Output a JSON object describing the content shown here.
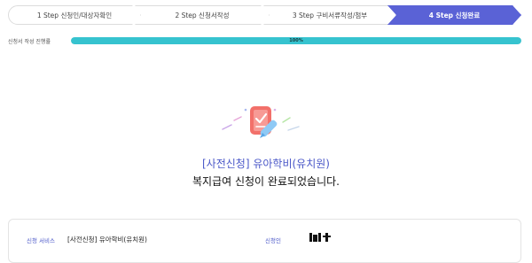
{
  "steps": [
    {
      "label": "1 Step 신청인/대상자확인",
      "active": false
    },
    {
      "label": "2 Step 신청서작성",
      "active": false
    },
    {
      "label": "3 Step 구비서류작성/첨부",
      "active": false
    },
    {
      "label": "4 Step 신청완료",
      "active": true
    }
  ],
  "progress": {
    "label": "신청서 작성 진행률",
    "value": 100,
    "text": "100%"
  },
  "service_title": "[사전신청] 유아학비(유치원)",
  "done_message": "복지급여 신청이 완료되었습니다.",
  "info": {
    "service_label": "신청 서비스",
    "service_value": "[사전신청] 유아학비(유치원)",
    "applicant_label": "신청인"
  },
  "colors": {
    "accent": "#5a62d6",
    "progress": "#36c3cf",
    "highlight": "#4a57c8"
  }
}
